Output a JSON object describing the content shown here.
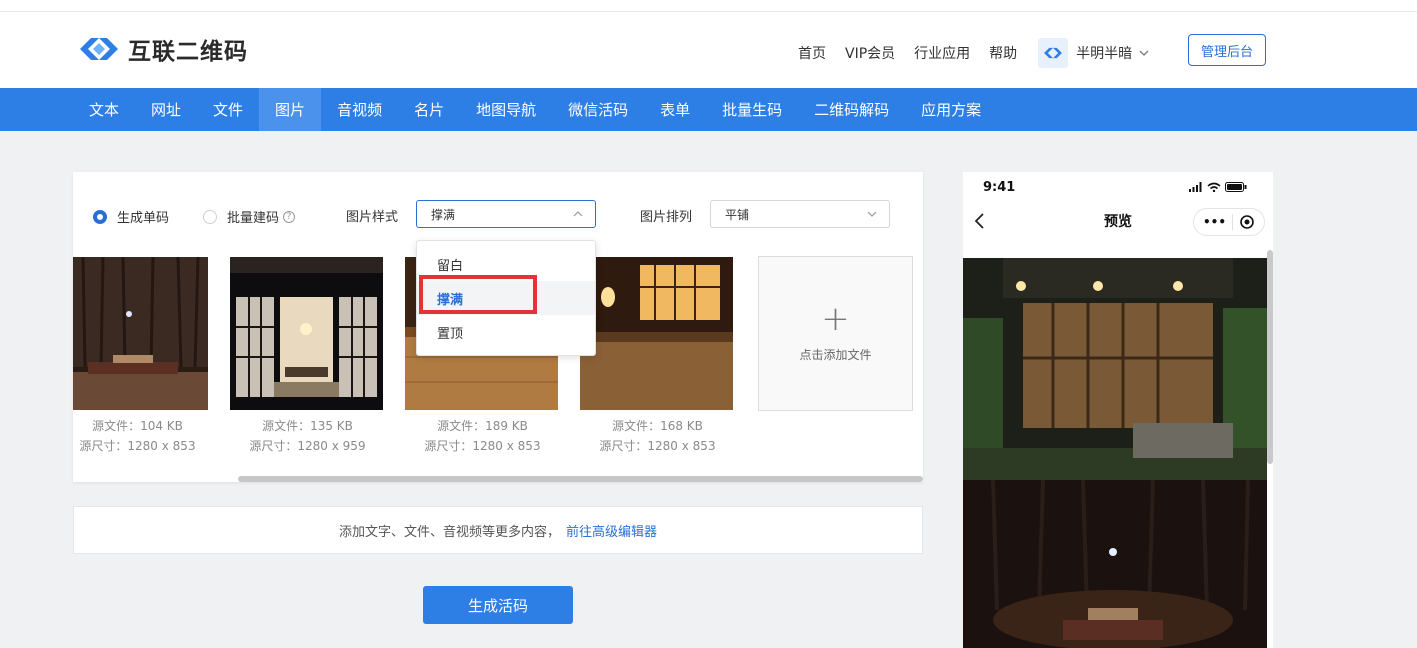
{
  "header": {
    "logo_text": "互联二维码",
    "nav": [
      "首页",
      "VIP会员",
      "行业应用",
      "帮助"
    ],
    "user_name": "半明半暗",
    "admin_button": "管理后台"
  },
  "main_nav": {
    "tabs": [
      "文本",
      "网址",
      "文件",
      "图片",
      "音视频",
      "名片",
      "地图导航",
      "微信活码",
      "表单",
      "批量生码",
      "二维码解码",
      "应用方案"
    ],
    "active_index": 3
  },
  "options": {
    "single_code": "生成单码",
    "batch_code": "批量建码",
    "help_glyph": "?",
    "image_style_label": "图片样式",
    "image_style_value": "撑满",
    "image_arrange_label": "图片排列",
    "image_arrange_value": "平铺"
  },
  "style_dropdown": {
    "options": [
      "留白",
      "撑满",
      "置顶"
    ],
    "selected_index": 1
  },
  "files": [
    {
      "size": "源文件：104 KB",
      "dims": "源尺寸：1280 x 853"
    },
    {
      "size": "源文件：135 KB",
      "dims": "源尺寸：1280 x 959"
    },
    {
      "size": "源文件：189 KB",
      "dims": "源尺寸：1280 x 853"
    },
    {
      "size": "源文件：168 KB",
      "dims": "源尺寸：1280 x 853"
    }
  ],
  "add_file": {
    "plus": "+",
    "label": "点击添加文件"
  },
  "advanced": {
    "text": "添加文字、文件、音视频等更多内容，",
    "link": "前往高级编辑器"
  },
  "generate_button": "生成活码",
  "preview": {
    "time": "9:41",
    "title": "预览",
    "capsule_dots": "•••"
  },
  "colors": {
    "brand_blue": "#2d7ee5",
    "link_blue": "#2a6fd6",
    "highlight_red": "#e5323a"
  }
}
